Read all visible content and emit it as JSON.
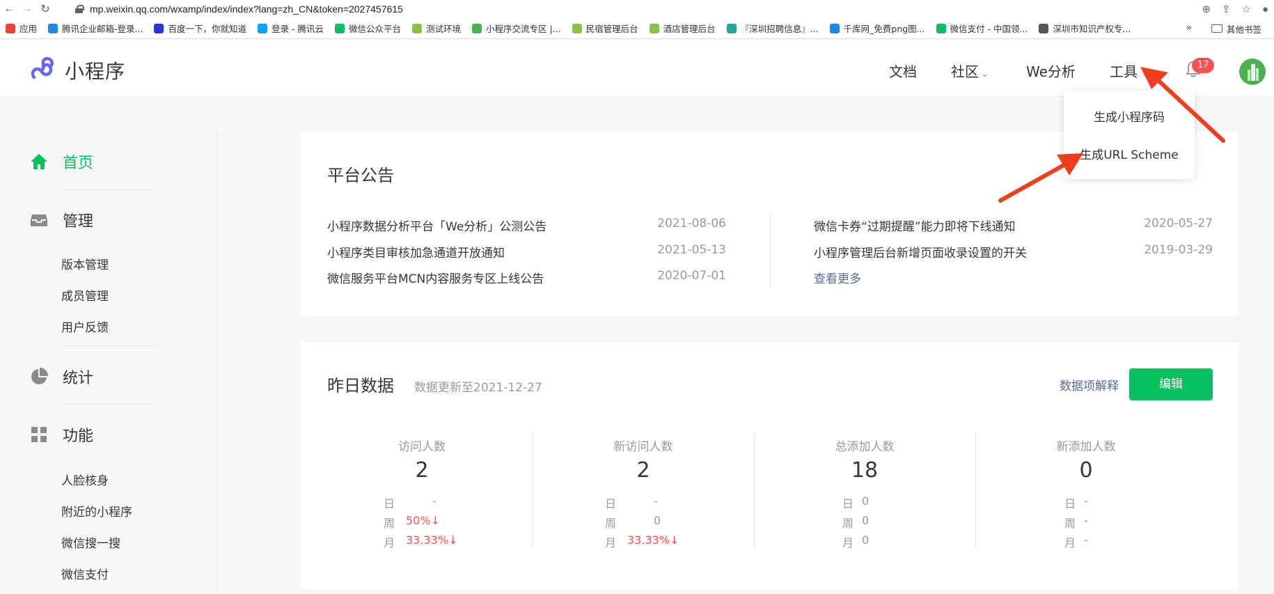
{
  "browser": {
    "url": "mp.weixin.qq.com/wxamp/index/index?lang=zh_CN&token=2027457615",
    "bookmarks": [
      {
        "label": "应用",
        "color": "#ea4335"
      },
      {
        "label": "腾讯企业邮箱-登录...",
        "color": "#1e88e5"
      },
      {
        "label": "百度一下，你就知道",
        "color": "#2932e1"
      },
      {
        "label": "登录 - 腾讯云",
        "color": "#00a3ff"
      },
      {
        "label": "微信公众平台",
        "color": "#07c160"
      },
      {
        "label": "测试环境",
        "color": "#8bc34a"
      },
      {
        "label": "小程序交流专区 |...",
        "color": "#4caf50"
      },
      {
        "label": "民宿管理后台",
        "color": "#8bc34a"
      },
      {
        "label": "酒店管理后台",
        "color": "#8bc34a"
      },
      {
        "label": "『深圳招聘信息』...",
        "color": "#26a69a"
      },
      {
        "label": "千库网_免费png图...",
        "color": "#1e88e5"
      },
      {
        "label": "微信支付 - 中国领...",
        "color": "#07c160"
      },
      {
        "label": "深圳市知识产权专...",
        "color": "#555555"
      }
    ],
    "more": "»",
    "other_bookmarks": "其他书签"
  },
  "header": {
    "logo_text": "小程序",
    "nav": {
      "docs": "文档",
      "community": "社区",
      "analytics": "We分析",
      "tools": "工具"
    },
    "notification_count": "17"
  },
  "tools_menu": {
    "items": [
      "生成小程序码",
      "生成URL Scheme"
    ]
  },
  "sidebar": {
    "home": "首页",
    "manage": "管理",
    "manage_items": [
      "版本管理",
      "成员管理",
      "用户反馈"
    ],
    "stats": "统计",
    "features": "功能",
    "feature_items": [
      "人脸核身",
      "附近的小程序",
      "微信搜一搜",
      "微信支付"
    ]
  },
  "announcements": {
    "title": "平台公告",
    "left": [
      {
        "text": "小程序数据分析平台「We分析」公测公告",
        "date": "2021-08-06"
      },
      {
        "text": "小程序类目审核加急通道开放通知",
        "date": "2021-05-13"
      },
      {
        "text": "微信服务平台MCN内容服务专区上线公告",
        "date": "2020-07-01"
      }
    ],
    "right": [
      {
        "text": "微信卡券“过期提醒”能力即将下线通知",
        "date": "2020-05-27"
      },
      {
        "text": "小程序管理后台新增页面收录设置的开关",
        "date": "2019-03-29"
      }
    ],
    "more": "查看更多"
  },
  "yesterday": {
    "title": "昨日数据",
    "updated": "数据更新至2021-12-27",
    "explain": "数据项解释",
    "edit": "编辑",
    "row_labels": {
      "day": "日",
      "week": "周",
      "month": "月"
    },
    "stats": [
      {
        "label": "访问人数",
        "value": "2",
        "day": "-",
        "week": "50%↓",
        "month": "33.33%↓"
      },
      {
        "label": "新访问人数",
        "value": "2",
        "day": "-",
        "week": "0",
        "month": "33.33%↓"
      },
      {
        "label": "总添加人数",
        "value": "18",
        "day": "0",
        "week": "0",
        "month": "0"
      },
      {
        "label": "新添加人数",
        "value": "0",
        "day": "-",
        "week": "-",
        "month": "-"
      }
    ]
  },
  "colors": {
    "brand_green": "#07c160",
    "link": "#576b95",
    "decline_red": "#fa5151",
    "annotation_arrow": "#f23c1e"
  }
}
